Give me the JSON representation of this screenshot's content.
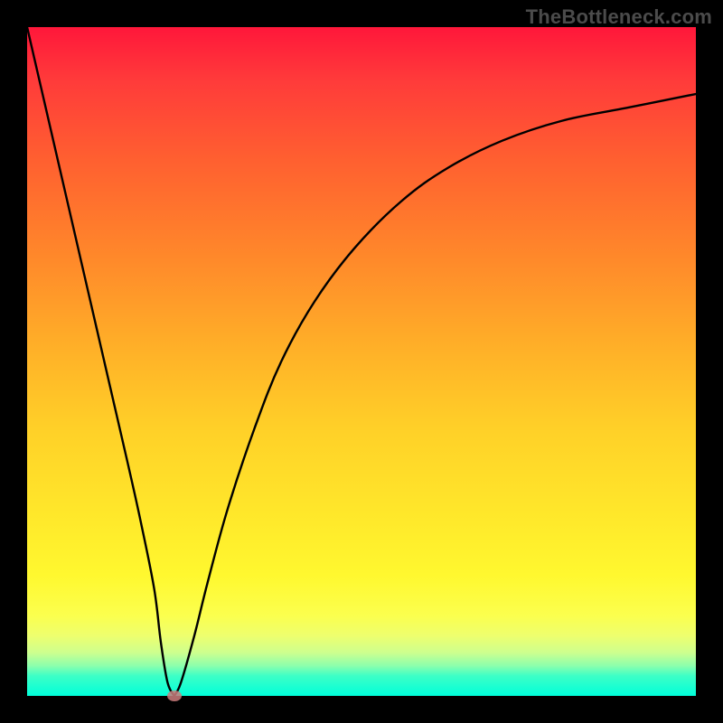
{
  "watermark": "TheBottleneck.com",
  "colors": {
    "frame": "#000000",
    "curve": "#000000",
    "marker": "#cc7d7d"
  },
  "chart_data": {
    "type": "line",
    "title": "",
    "xlabel": "",
    "ylabel": "",
    "xlim": [
      0,
      100
    ],
    "ylim": [
      0,
      100
    ],
    "grid": false,
    "legend": false,
    "annotations": [
      "TheBottleneck.com"
    ],
    "series": [
      {
        "name": "bottleneck-curve",
        "x": [
          0,
          3,
          6,
          9,
          12,
          15,
          17,
          19,
          20,
          21,
          22,
          23,
          25,
          27,
          30,
          34,
          38,
          43,
          49,
          56,
          63,
          71,
          80,
          90,
          100
        ],
        "y": [
          100,
          87,
          74,
          61,
          48,
          35,
          26,
          16,
          8,
          2,
          0,
          2,
          9,
          17,
          28,
          40,
          50,
          59,
          67,
          74,
          79,
          83,
          86,
          88,
          90
        ]
      }
    ],
    "marker": {
      "x": 22,
      "y": 0
    }
  }
}
